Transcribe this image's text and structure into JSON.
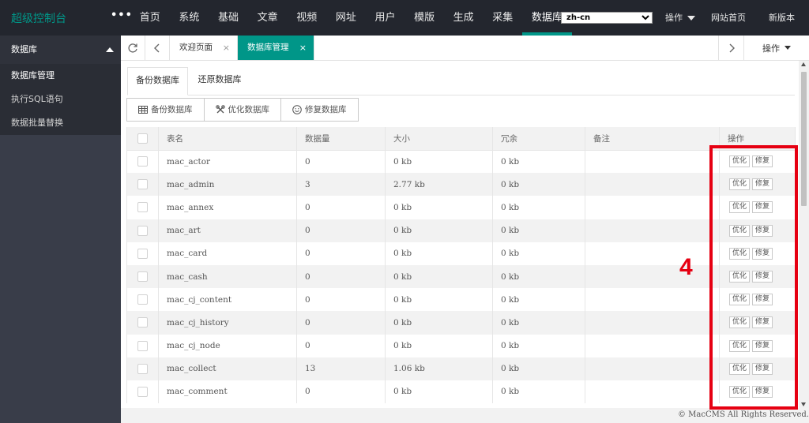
{
  "topbar": {
    "logo": "超级控制台",
    "menu_toggle": "•••",
    "nav": [
      "首页",
      "系统",
      "基础",
      "文章",
      "视频",
      "网址",
      "用户",
      "模版",
      "生成",
      "采集",
      "数据库"
    ],
    "active_nav": "数据库",
    "lang_select_value": "zh-cn",
    "ops_label": "操作",
    "site_home": "网站首页",
    "new_version": "新版本"
  },
  "sidebar": {
    "section_title": "数据库",
    "items": [
      "数据库管理",
      "执行SQL语句",
      "数据批量替换"
    ]
  },
  "tabbar": {
    "tabs": [
      {
        "label": "欢迎页面",
        "close": "×"
      },
      {
        "label": "数据库管理",
        "close": "×"
      }
    ],
    "ops_label": "操作"
  },
  "subtabs": [
    "备份数据库",
    "还原数据库"
  ],
  "toolbar": {
    "backup": "备份数据库",
    "optimize": "优化数据库",
    "repair": "修复数据库"
  },
  "table": {
    "headers": [
      "表名",
      "数据量",
      "大小",
      "冗余",
      "备注",
      "操作"
    ],
    "optimize_btn": "优化",
    "repair_btn": "修复",
    "rows": [
      {
        "name": "mac_actor",
        "count": "0",
        "size": "0 kb",
        "redundant": "0 kb",
        "note": ""
      },
      {
        "name": "mac_admin",
        "count": "3",
        "size": "2.77 kb",
        "redundant": "0 kb",
        "note": ""
      },
      {
        "name": "mac_annex",
        "count": "0",
        "size": "0 kb",
        "redundant": "0 kb",
        "note": ""
      },
      {
        "name": "mac_art",
        "count": "0",
        "size": "0 kb",
        "redundant": "0 kb",
        "note": ""
      },
      {
        "name": "mac_card",
        "count": "0",
        "size": "0 kb",
        "redundant": "0 kb",
        "note": ""
      },
      {
        "name": "mac_cash",
        "count": "0",
        "size": "0 kb",
        "redundant": "0 kb",
        "note": ""
      },
      {
        "name": "mac_cj_content",
        "count": "0",
        "size": "0 kb",
        "redundant": "0 kb",
        "note": ""
      },
      {
        "name": "mac_cj_history",
        "count": "0",
        "size": "0 kb",
        "redundant": "0 kb",
        "note": ""
      },
      {
        "name": "mac_cj_node",
        "count": "0",
        "size": "0 kb",
        "redundant": "0 kb",
        "note": ""
      },
      {
        "name": "mac_collect",
        "count": "13",
        "size": "1.06 kb",
        "redundant": "0 kb",
        "note": ""
      },
      {
        "name": "mac_comment",
        "count": "0",
        "size": "0 kb",
        "redundant": "0 kb",
        "note": ""
      }
    ]
  },
  "footer": "© MacCMS All Rights Reserved.",
  "annotation": {
    "number": "4",
    "color": "#e60012"
  },
  "colors": {
    "accent": "#009688",
    "topbar": "#23262e",
    "sidebar": "#393d49"
  }
}
